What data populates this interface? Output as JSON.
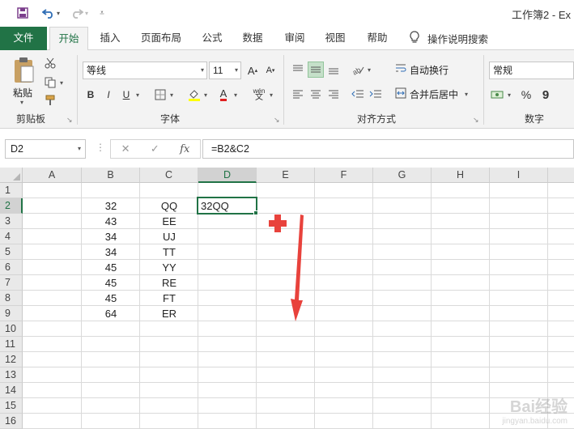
{
  "title": "工作簿2 - Ex",
  "tabs": [
    "文件",
    "开始",
    "插入",
    "页面布局",
    "公式",
    "数据",
    "审阅",
    "视图",
    "帮助"
  ],
  "tell_me": "操作说明搜索",
  "ribbon": {
    "clipboard": {
      "paste": "粘贴",
      "label": "剪贴板"
    },
    "font": {
      "name": "等线",
      "size": "11",
      "label": "字体",
      "bold": "B",
      "italic": "I",
      "underline": "U",
      "grow": "A",
      "shrink": "A",
      "color_a": "A",
      "wen": "wén"
    },
    "alignment": {
      "wrap": "自动换行",
      "merge": "合并后居中",
      "label": "对齐方式"
    },
    "number": {
      "format": "常规",
      "percent": "%",
      "comma": "9",
      "label": "数字"
    }
  },
  "formula_bar": {
    "name_box": "D2",
    "fx": "fx",
    "formula": "=B2&C2"
  },
  "grid": {
    "columns": [
      "A",
      "B",
      "C",
      "D",
      "E",
      "F",
      "G",
      "H",
      "I"
    ],
    "selected_column": "D",
    "selected_row": 2,
    "rows": [
      1,
      2,
      3,
      4,
      5,
      6,
      7,
      8,
      9,
      10,
      11,
      12,
      13,
      14,
      15,
      16
    ],
    "B": [
      "",
      "32",
      "43",
      "34",
      "34",
      "45",
      "45",
      "45",
      "64"
    ],
    "C": [
      "",
      "QQ",
      "EE",
      "UJ",
      "TT",
      "YY",
      "RE",
      "FT",
      "ER"
    ],
    "D2": "32QQ"
  },
  "watermark": {
    "brand": "Bai经验",
    "url": "jingyan.baidu.com"
  },
  "colors": {
    "excel_green": "#217346",
    "annotation_red": "#e8423c"
  }
}
